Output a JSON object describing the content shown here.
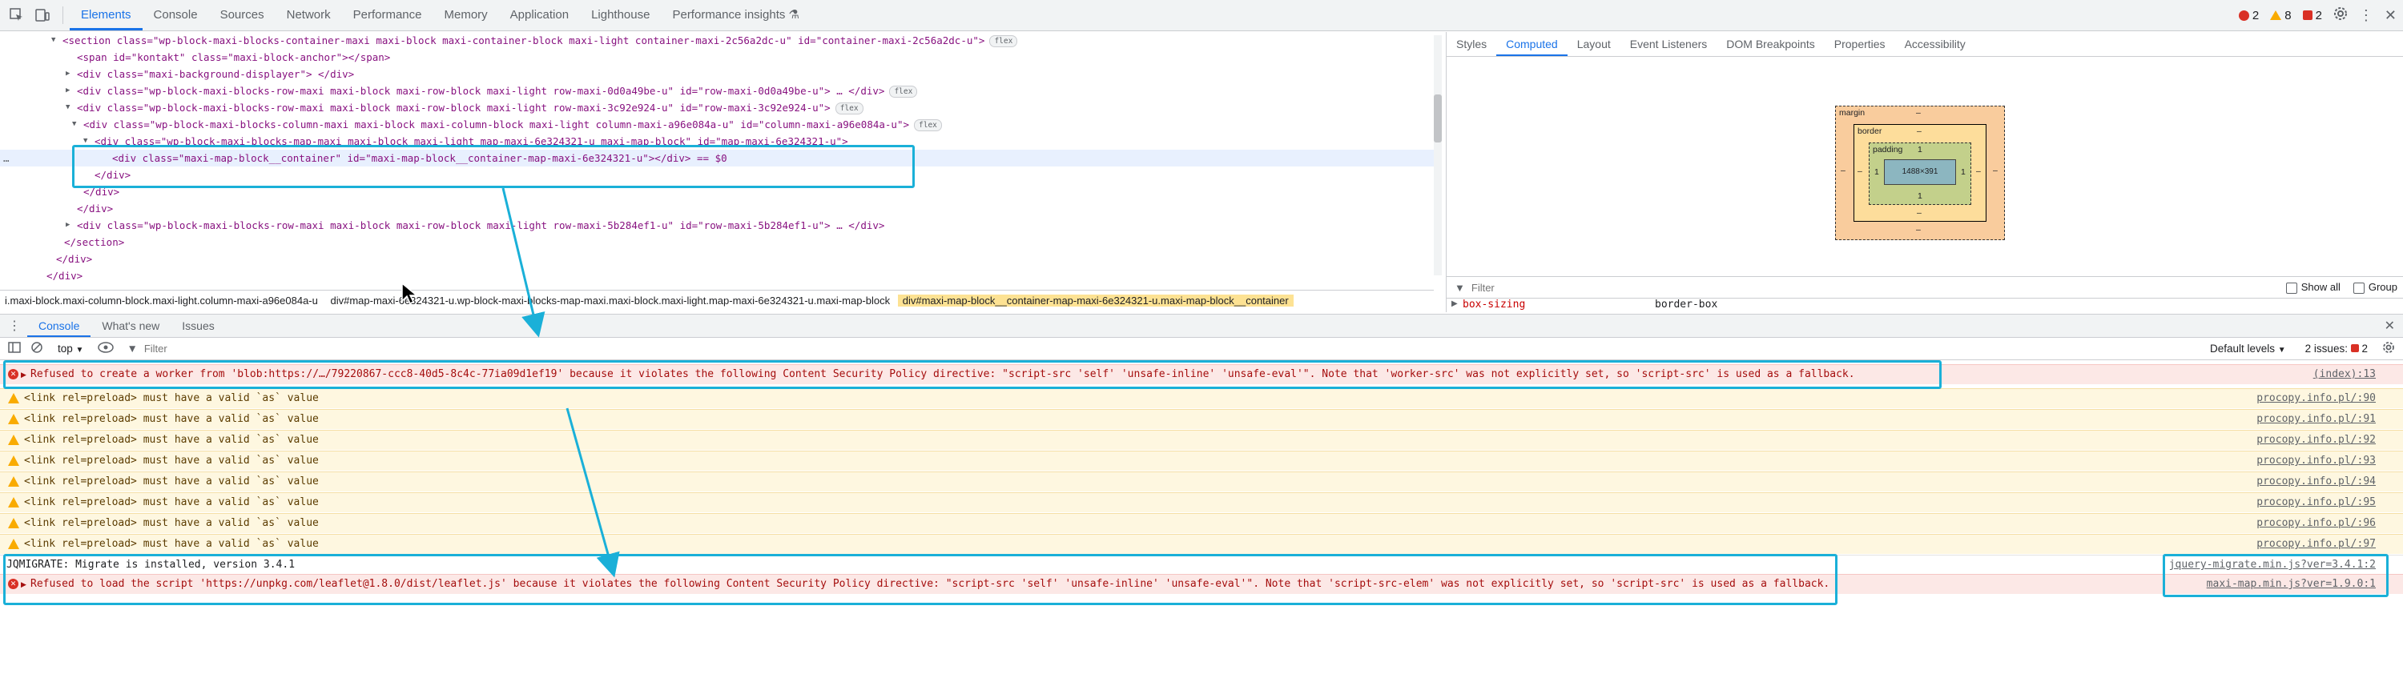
{
  "top_tabs": [
    "Elements",
    "Console",
    "Sources",
    "Network",
    "Performance",
    "Memory",
    "Application",
    "Lighthouse",
    "Performance insights"
  ],
  "issue_counts": {
    "errors": "2",
    "warnings": "8",
    "issues": "2"
  },
  "dom_lines": [
    "<section class=\"wp-block-maxi-blocks-container-maxi maxi-block maxi-container-block maxi-light container-maxi-2c56a2dc-u\" id=\"container-maxi-2c56a2dc-u\">",
    "<span id=\"kontakt\" class=\"maxi-block-anchor\"></span>",
    "<div class=\"maxi-background-displayer\"> </div>",
    "<div class=\"wp-block-maxi-blocks-row-maxi maxi-block maxi-row-block maxi-light row-maxi-0d0a49be-u\" id=\"row-maxi-0d0a49be-u\"> … </div>",
    "<div class=\"wp-block-maxi-blocks-row-maxi maxi-block maxi-row-block maxi-light row-maxi-3c92e924-u\" id=\"row-maxi-3c92e924-u\">",
    "<div class=\"wp-block-maxi-blocks-column-maxi maxi-block maxi-column-block maxi-light column-maxi-a96e084a-u\" id=\"column-maxi-a96e084a-u\">",
    "<div class=\"wp-block-maxi-blocks-map-maxi maxi-block maxi-light map-maxi-6e324321-u maxi-map-block\" id=\"map-maxi-6e324321-u\">",
    "<div class=\"maxi-map-block__container\" id=\"maxi-map-block__container-map-maxi-6e324321-u\"></div> == $0",
    "</div>",
    "</div>",
    "</div>",
    "<div class=\"wp-block-maxi-blocks-row-maxi maxi-block maxi-row-block maxi-light row-maxi-5b284ef1-u\" id=\"row-maxi-5b284ef1-u\"> … </div>",
    "</section>",
    "</div>",
    "</div>"
  ],
  "flex_badge": "flex",
  "breadcrumb": [
    "i.maxi-block.maxi-column-block.maxi-light.column-maxi-a96e084a-u",
    "div#map-maxi-6e324321-u.wp-block-maxi-blocks-map-maxi.maxi-block.maxi-light.map-maxi-6e324321-u.maxi-map-block",
    "div#maxi-map-block__container-map-maxi-6e324321-u.maxi-map-block__container"
  ],
  "styles_tabs": [
    "Styles",
    "Computed",
    "Layout",
    "Event Listeners",
    "DOM Breakpoints",
    "Properties",
    "Accessibility"
  ],
  "box_model": {
    "margin_label": "margin",
    "border_label": "border",
    "padding_label": "padding",
    "content": "1488×391",
    "dash": "–",
    "one": "1"
  },
  "computed_filter": {
    "placeholder": "Filter",
    "show_all": "Show all",
    "group": "Group"
  },
  "computed_property": {
    "name": "box-sizing",
    "value": "border-box"
  },
  "drawer_tabs": [
    "Console",
    "What's new",
    "Issues"
  ],
  "console_toolbar": {
    "context": "top",
    "filter_placeholder": "Filter",
    "levels": "Default levels",
    "issues": "2 issues:",
    "issues_count": "2"
  },
  "messages": [
    {
      "level": "error",
      "text": "Refused to create a worker from 'blob:https://…/79220867-ccc8-40d5-8c4c-77ia09d1ef19' because it violates the following Content Security Policy directive: \"script-src 'self' 'unsafe-inline' 'unsafe-eval'\". Note that 'worker-src' was not explicitly set, so 'script-src' is used as a fallback.",
      "source": "(index):13"
    },
    {
      "level": "warning",
      "text": "<link rel=preload> must have a valid `as` value",
      "source": "procopy.info.pl/:90"
    },
    {
      "level": "warning",
      "text": "<link rel=preload> must have a valid `as` value",
      "source": "procopy.info.pl/:91"
    },
    {
      "level": "warning",
      "text": "<link rel=preload> must have a valid `as` value",
      "source": "procopy.info.pl/:92"
    },
    {
      "level": "warning",
      "text": "<link rel=preload> must have a valid `as` value",
      "source": "procopy.info.pl/:93"
    },
    {
      "level": "warning",
      "text": "<link rel=preload> must have a valid `as` value",
      "source": "procopy.info.pl/:94"
    },
    {
      "level": "warning",
      "text": "<link rel=preload> must have a valid `as` value",
      "source": "procopy.info.pl/:95"
    },
    {
      "level": "warning",
      "text": "<link rel=preload> must have a valid `as` value",
      "source": "procopy.info.pl/:96"
    },
    {
      "level": "warning",
      "text": "<link rel=preload> must have a valid `as` value",
      "source": "procopy.info.pl/:97"
    },
    {
      "level": "info",
      "text": "JQMIGRATE: Migrate is installed, version 3.4.1",
      "source": "jquery-migrate.min.js?ver=3.4.1:2"
    },
    {
      "level": "error",
      "text": "Refused to load the script 'https://unpkg.com/leaflet@1.8.0/dist/leaflet.js' because it violates the following Content Security Policy directive: \"script-src 'self' 'unsafe-inline' 'unsafe-eval'\". Note that 'script-src-elem' was not explicitly set, so 'script-src' is used as a fallback.",
      "source": "maxi-map.min.js?ver=1.9.0:1"
    }
  ],
  "colors": {
    "accent": "#1a73e8",
    "highlight": "#1ab0d8",
    "error": "#d93025",
    "warning": "#f9ab00"
  }
}
